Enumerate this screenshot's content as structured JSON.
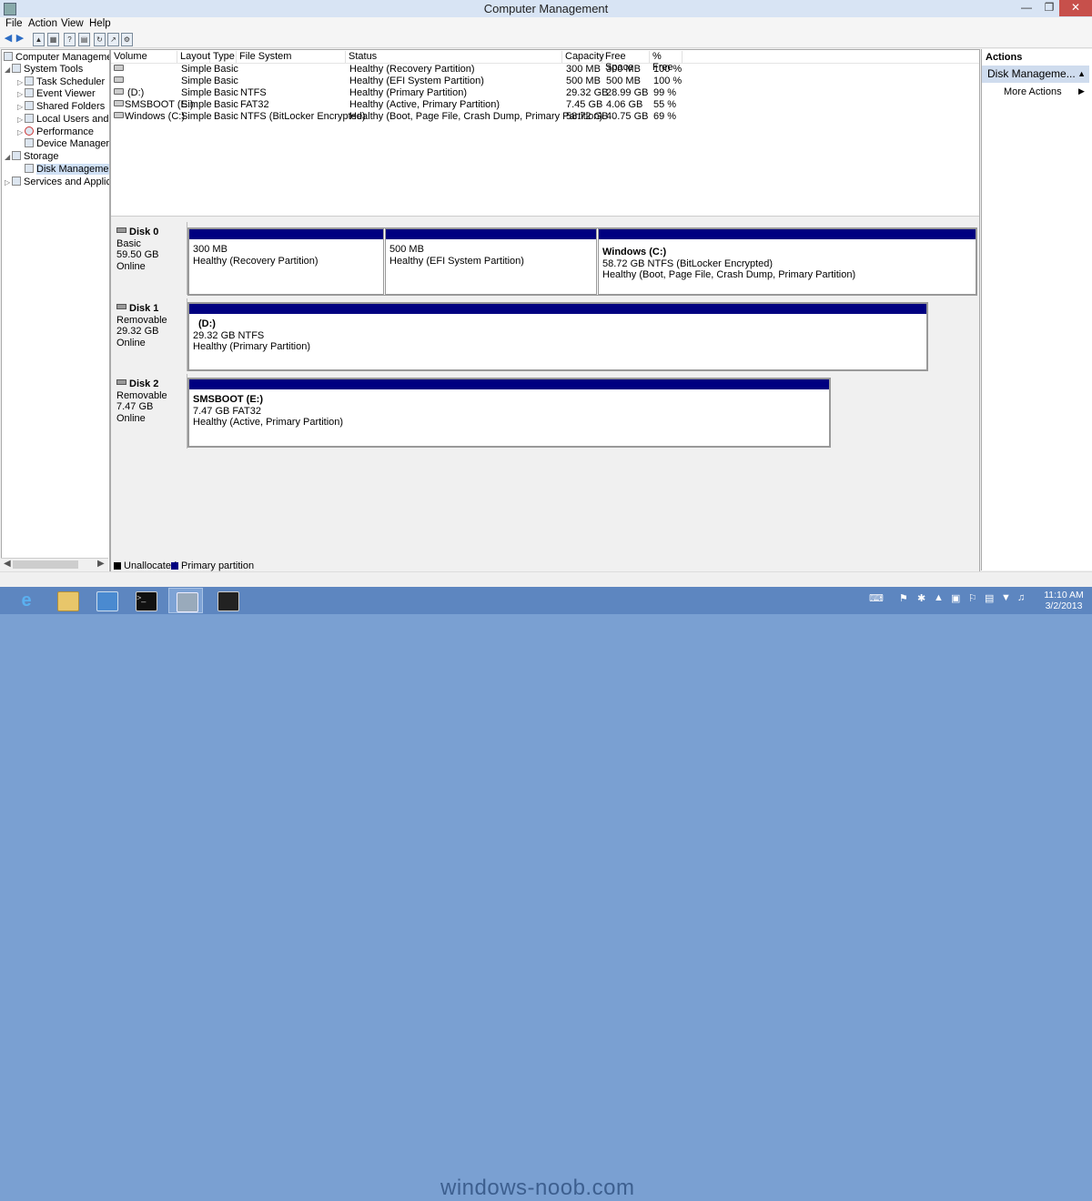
{
  "window": {
    "title": "Computer Management"
  },
  "menu": [
    "File",
    "Action",
    "View",
    "Help"
  ],
  "tree": {
    "root": "Computer Management",
    "items": [
      "System Tools",
      "Task Scheduler",
      "Event Viewer",
      "Shared Folders",
      "Local Users and G",
      "Performance",
      "Device Manager",
      "Storage",
      "Disk Management",
      "Services and Applicat"
    ]
  },
  "volume_list": {
    "headers": [
      "Volume",
      "Layout",
      "Type",
      "File System",
      "Status",
      "Capacity",
      "Free Space",
      "% Free"
    ],
    "rows": [
      [
        "",
        "Simple",
        "Basic",
        "",
        "Healthy (Recovery Partition)",
        "300 MB",
        "300 MB",
        "100 %"
      ],
      [
        "",
        "Simple",
        "Basic",
        "",
        "Healthy (EFI System Partition)",
        "500 MB",
        "500 MB",
        "100 %"
      ],
      [
        "(D:)",
        "Simple",
        "Basic",
        "NTFS",
        "Healthy (Primary Partition)",
        "29.32 GB",
        "28.99 GB",
        "99 %"
      ],
      [
        "SMSBOOT (E:)",
        "Simple",
        "Basic",
        "FAT32",
        "Healthy (Active, Primary Partition)",
        "7.45 GB",
        "4.06 GB",
        "55 %"
      ],
      [
        "Windows (C:)",
        "Simple",
        "Basic",
        "NTFS (BitLocker Encrypted)",
        "Healthy (Boot, Page File, Crash Dump, Primary Partition)",
        "58.72 GB",
        "40.75 GB",
        "69 %"
      ]
    ]
  },
  "disks": [
    {
      "name": "Disk 0",
      "type": "Basic",
      "size": "59.50 GB",
      "status": "Online",
      "partitions": [
        {
          "name": "",
          "size": "300 MB",
          "status": "Healthy (Recovery Partition)"
        },
        {
          "name": "",
          "size": "500 MB",
          "status": "Healthy (EFI System Partition)"
        },
        {
          "name": "Windows  (C:)",
          "size": "58.72 GB NTFS (BitLocker Encrypted)",
          "status": "Healthy (Boot, Page File, Crash Dump, Primary Partition)"
        }
      ]
    },
    {
      "name": "Disk 1",
      "type": "Removable",
      "size": "29.32 GB",
      "status": "Online",
      "partitions": [
        {
          "name": "(D:)",
          "size": "29.32 GB NTFS",
          "status": "Healthy (Primary Partition)"
        }
      ]
    },
    {
      "name": "Disk 2",
      "type": "Removable",
      "size": "7.47 GB",
      "status": "Online",
      "partitions": [
        {
          "name": "SMSBOOT  (E:)",
          "size": "7.47 GB FAT32",
          "status": "Healthy (Active, Primary Partition)"
        }
      ]
    }
  ],
  "legend": [
    {
      "label": "Unallocated",
      "color": "#000000"
    },
    {
      "label": "Primary partition",
      "color": "#000080"
    }
  ],
  "actions": {
    "title": "Actions",
    "section": "Disk Manageme...",
    "more": "More Actions"
  },
  "taskbar": {
    "watermark": "windows-noob.com",
    "time": "11:10 AM",
    "date": "3/2/2013"
  }
}
